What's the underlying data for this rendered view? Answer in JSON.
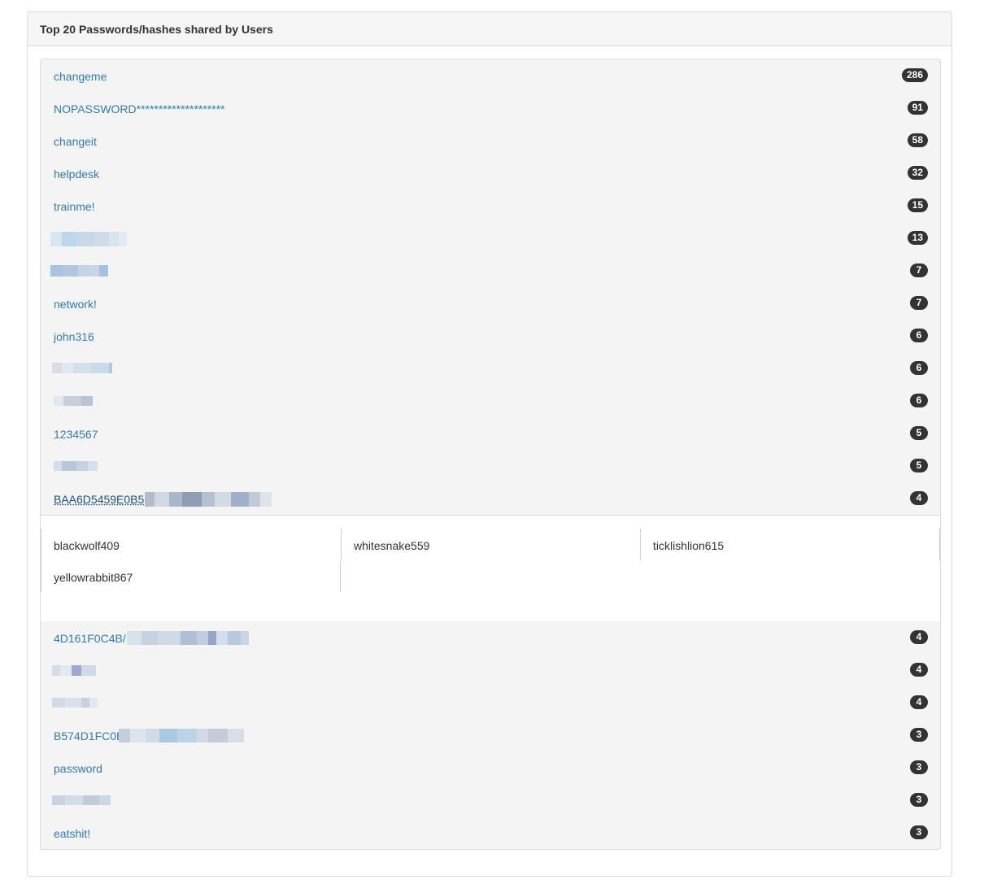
{
  "panel": {
    "title": "Top 20 Passwords/hashes shared by Users"
  },
  "rows": [
    {
      "label": "changeme",
      "count": "286"
    },
    {
      "label": "NOPASSWORD********************",
      "count": "91"
    },
    {
      "label": "changeit",
      "count": "58"
    },
    {
      "label": "helpdesk",
      "count": "32"
    },
    {
      "label": "trainme!",
      "count": "15"
    },
    {
      "label": "",
      "count": "13"
    },
    {
      "label": "",
      "count": "7"
    },
    {
      "label": "network!",
      "count": "7"
    },
    {
      "label": "john316",
      "count": "6"
    },
    {
      "label": "",
      "count": "6"
    },
    {
      "label": "",
      "count": "6"
    },
    {
      "label": "1234567",
      "count": "5"
    },
    {
      "label": "",
      "count": "5"
    },
    {
      "label": "BAA6D5459E0B5",
      "count": "4"
    },
    {
      "label": "4D161F0C4B/",
      "count": "4"
    },
    {
      "label": "",
      "count": "4"
    },
    {
      "label": "",
      "count": "4"
    },
    {
      "label": "B574D1FC0E",
      "count": "3"
    },
    {
      "label": "password",
      "count": "3"
    },
    {
      "label": "",
      "count": "3"
    },
    {
      "label": "eatshit!",
      "count": "3"
    }
  ],
  "users": [
    "blackwolf409",
    "whitesnake559",
    "ticklishlion615",
    "yellowrabbit867"
  ],
  "colors": {
    "link": "#337ab7",
    "badge": "#333333",
    "list_bg": "#f4f4f4",
    "heading_bg": "#f5f5f5"
  }
}
